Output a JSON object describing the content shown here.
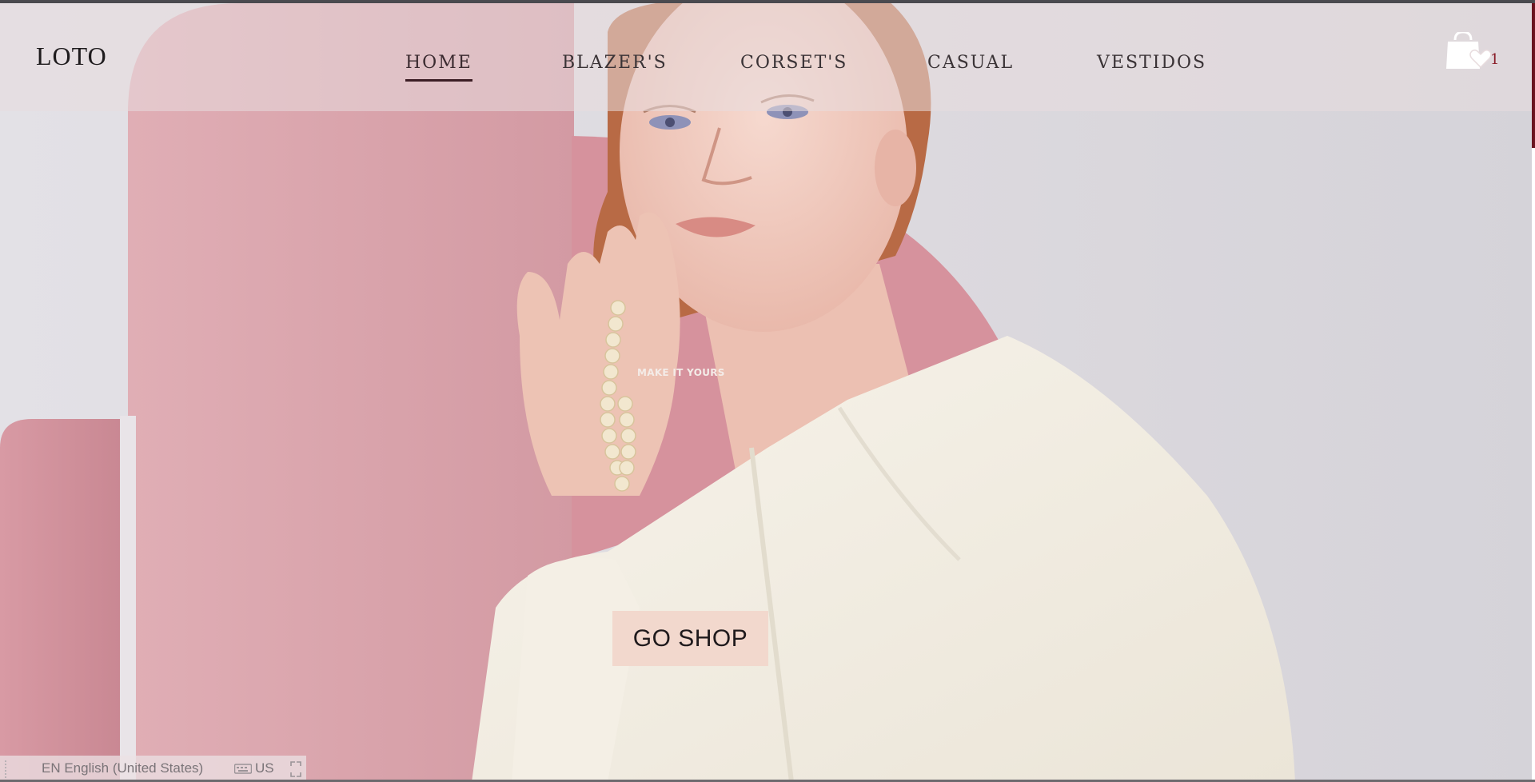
{
  "header": {
    "logo": "LOTO",
    "nav": [
      {
        "label": "HOME",
        "active": true
      },
      {
        "label": "BLAZER'S",
        "active": false
      },
      {
        "label": "CORSET'S",
        "active": false
      },
      {
        "label": "CASUAL",
        "active": false
      },
      {
        "label": "VESTIDOS",
        "active": false
      }
    ],
    "cart": {
      "icon": "shopping-bag-heart-icon",
      "count": "1"
    }
  },
  "hero": {
    "tagline": "MAKE IT YOURS",
    "cta_label": "GO SHOP",
    "image": "woman-in-white-blazer-holding-pearl-necklace"
  },
  "language_bar": {
    "language": "EN English (United States)",
    "keyboard": "US",
    "keyboard_icon": "keyboard-icon",
    "expand_icon": "expand-icon"
  },
  "colors": {
    "accent": "#8a1c28",
    "cta_background": "#f2d8cd",
    "nav_underline": "#3c1e25",
    "pink_panels": "#d9a3ab"
  }
}
